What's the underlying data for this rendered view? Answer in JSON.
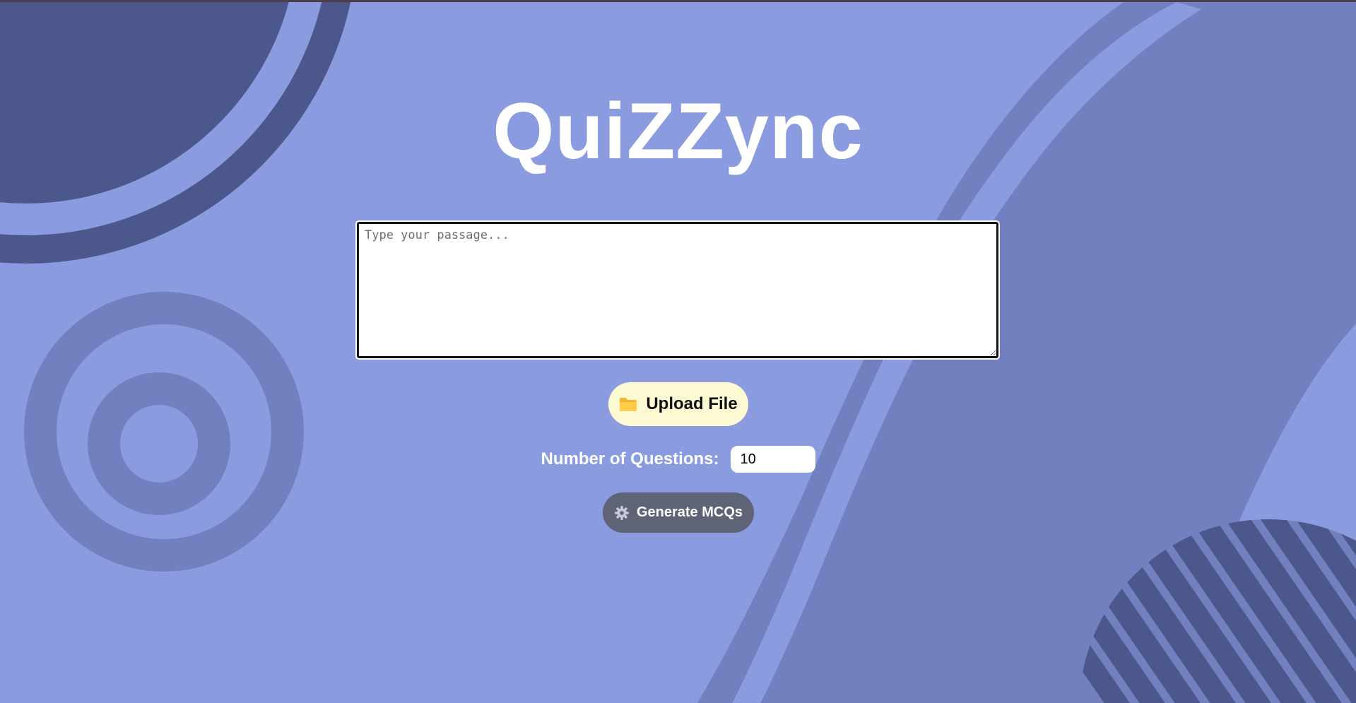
{
  "app": {
    "title": "QuiZZync"
  },
  "passage": {
    "placeholder": "Type your passage...",
    "value": ""
  },
  "upload": {
    "label": "Upload File",
    "icon": "folder-icon"
  },
  "questions": {
    "label": "Number of Questions:",
    "value": "10"
  },
  "generate": {
    "label": "Generate MCQs",
    "icon": "gear-icon"
  },
  "colors": {
    "background": "#8b9be0",
    "shape_dark": "#4c588c",
    "shape_mid": "#7380c0",
    "upload_button": "#fdf9d3",
    "generate_button": "#5e6475",
    "title": "#ffffff"
  }
}
